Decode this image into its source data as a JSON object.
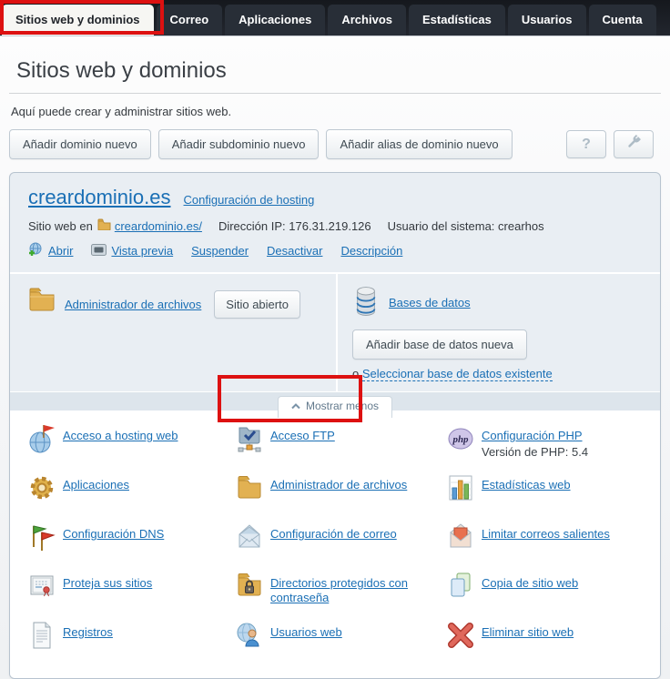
{
  "annotation_color": "#dd1111",
  "tabs": [
    "Sitios web y dominios",
    "Correo",
    "Aplicaciones",
    "Archivos",
    "Estadísticas",
    "Usuarios",
    "Cuenta"
  ],
  "page": {
    "title": "Sitios web y dominios",
    "subtitle": "Aquí puede crear y administrar sitios web."
  },
  "toolbar": {
    "buttons": [
      "Añadir dominio nuevo",
      "Añadir subdominio nuevo",
      "Añadir alias de dominio nuevo"
    ],
    "help_label": "?"
  },
  "domain": {
    "name": "creardominio.es",
    "hosting_link": "Configuración de hosting",
    "site_prefix": "Sitio web en",
    "site_path": "creardominio.es/",
    "ip_label": "Dirección IP:",
    "ip": "176.31.219.126",
    "user_label": "Usuario del sistema:",
    "user": "crearhos",
    "actions": [
      "Abrir",
      "Vista previa",
      "Suspender",
      "Desactivar",
      "Descripción"
    ]
  },
  "tools": {
    "file_manager_link": "Administrador de archivos",
    "open_site_button": "Sitio abierto",
    "databases_link": "Bases de datos",
    "add_db_button": "Añadir base de datos nueva",
    "or_label": "o",
    "select_db_link": "Seleccionar base de datos existente"
  },
  "show_less_label": "Mostrar menos",
  "menu": {
    "items": [
      {
        "label": "Acceso a hosting web",
        "icon": "hosting-access-icon"
      },
      {
        "label": "Acceso FTP",
        "icon": "ftp-icon",
        "highlighted": true
      },
      {
        "label": "Configuración PHP",
        "sub": "Versión de PHP: 5.4",
        "icon": "php-icon"
      },
      {
        "label": "Aplicaciones",
        "icon": "gear-icon"
      },
      {
        "label": "Administrador de archivos",
        "icon": "folder-icon"
      },
      {
        "label": "Estadísticas web",
        "icon": "bar-chart-icon"
      },
      {
        "label": "Configuración DNS",
        "icon": "flags-icon"
      },
      {
        "label": "Configuración de correo",
        "icon": "mail-icon"
      },
      {
        "label": "Limitar correos salientes",
        "icon": "mail-limit-icon"
      },
      {
        "label": "Proteja sus sitios",
        "icon": "certificate-icon"
      },
      {
        "label": "Directorios protegidos con contraseña",
        "icon": "folder-lock-icon"
      },
      {
        "label": "Copia de sitio web",
        "icon": "copy-pages-icon"
      },
      {
        "label": "Registros",
        "icon": "log-file-icon"
      },
      {
        "label": "Usuarios web",
        "icon": "web-users-icon"
      },
      {
        "label": "Eliminar sitio web",
        "icon": "delete-x-icon"
      }
    ]
  }
}
